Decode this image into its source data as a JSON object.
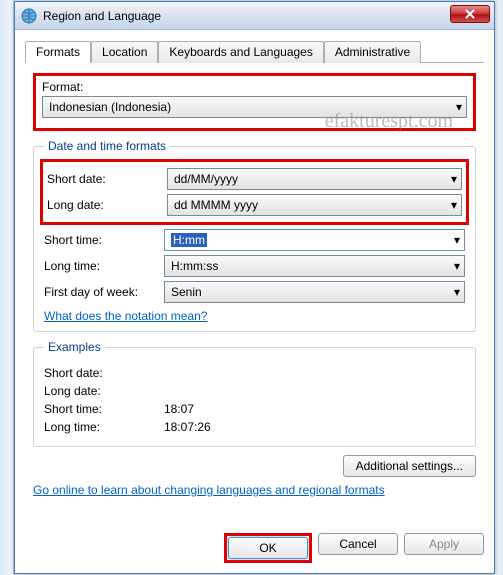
{
  "window": {
    "title": "Region and Language"
  },
  "tabs": {
    "formats": "Formats",
    "location": "Location",
    "keyboards": "Keyboards and Languages",
    "administrative": "Administrative"
  },
  "format": {
    "label": "Format:",
    "value": "Indonesian (Indonesia)"
  },
  "dtf": {
    "legend": "Date and time formats",
    "short_date_label": "Short date:",
    "short_date_value": "dd/MM/yyyy",
    "long_date_label": "Long date:",
    "long_date_value": "dd MMMM yyyy",
    "short_time_label": "Short time:",
    "short_time_value": "H:mm",
    "long_time_label": "Long time:",
    "long_time_value": "H:mm:ss",
    "first_day_label": "First day of week:",
    "first_day_value": "Senin",
    "notation_link": "What does the notation mean?"
  },
  "examples": {
    "legend": "Examples",
    "short_date_label": "Short date:",
    "short_date_value": "",
    "long_date_label": "Long date:",
    "long_date_value": "",
    "short_time_label": "Short time:",
    "short_time_value": "18:07",
    "long_time_label": "Long time:",
    "long_time_value": "18:07:26"
  },
  "buttons": {
    "additional": "Additional settings...",
    "ok": "OK",
    "cancel": "Cancel",
    "apply": "Apply"
  },
  "links": {
    "go_online": "Go online to learn about changing languages and regional formats"
  },
  "watermark": "efakturespt.com"
}
